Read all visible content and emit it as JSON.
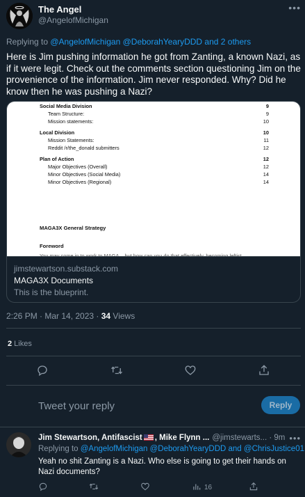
{
  "tweet": {
    "author_name": "The Angel",
    "author_handle": "@AngelofMichigan",
    "more_icon": "more-icon",
    "replying_prefix": "Replying to ",
    "replying_to": "@AngelofMichigan @DeborahYearyDDD and 2 others",
    "text": "Here is Jim pushing information he got from Zanting, a known Nazi, as if it were legit. Check out the comments section questioning Jim on the provenience of the information. Jim never responded. Why? Did he know then he was pushing a Nazi?",
    "card": {
      "doc_rows": [
        {
          "label": "Social Media Division",
          "page": "9",
          "bold": true
        },
        {
          "label": "Team Structure:",
          "page": "9",
          "bold": false
        },
        {
          "label": "Mission statements:",
          "page": "10",
          "bold": false
        },
        {
          "label": "Local Division",
          "page": "10",
          "bold": true
        },
        {
          "label": "Mission Statements:",
          "page": "11",
          "bold": false
        },
        {
          "label": "Reddit /r/the_donald submitters",
          "page": "12",
          "bold": false
        },
        {
          "label": "Plan of Action",
          "page": "12",
          "bold": true
        },
        {
          "label": "Major Objectives (Overall)",
          "page": "12",
          "bold": false
        },
        {
          "label": "Minor Objectives (Social Media)",
          "page": "14",
          "bold": false
        },
        {
          "label": "Minor Objectives (Regional)",
          "page": "14",
          "bold": false
        }
      ],
      "doc_heading_1": "MAGA3X General Strategy",
      "doc_heading_2": "Foreword",
      "doc_faded": "You may come in to work to MAGA... but how can you do that effectively, becoming leftist",
      "domain": "jimstewartson.substack.com",
      "title": "MAGA3X Documents",
      "description": "This is the blueprint."
    },
    "timestamp": "2:26 PM · Mar 14, 2023 · ",
    "views_count": "34",
    "views_label": " Views",
    "likes_count": "2",
    "likes_label": " Likes"
  },
  "actions": {
    "reply_icon": "reply-icon",
    "retweet_icon": "retweet-icon",
    "like_icon": "like-icon",
    "share_icon": "share-icon"
  },
  "compose": {
    "placeholder": "Tweet your reply",
    "button_label": "Reply"
  },
  "reply": {
    "author_name_part1": "Jim Stewartson, Antifascist",
    "author_name_part2": ", Mike Flynn ...",
    "author_handle": "@jimstewarts...",
    "time": " · 9m",
    "replying_prefix": "Replying to ",
    "replying_to": "@AngelofMichigan @DeborahYearyDDD and @ChrisJustice01",
    "text": "Yeah no shit Zanting is a Nazi. Who else is going to get their hands on Nazi documents?",
    "views_count": "16"
  },
  "colors": {
    "background": "#15202b",
    "accent": "#1d9bf0",
    "muted": "#8b98a5",
    "border": "#38444d"
  }
}
